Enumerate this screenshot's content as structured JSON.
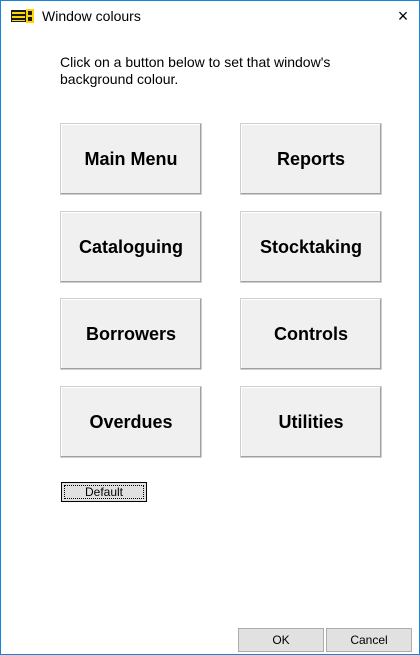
{
  "window": {
    "title": "Window colours",
    "close_glyph": "×",
    "app_icon": "library-app-icon"
  },
  "instructions": "Click on a button below to set that window's background colour.",
  "buttons": {
    "main_menu": "Main Menu",
    "reports": "Reports",
    "cataloguing": "Cataloguing",
    "stocktaking": "Stocktaking",
    "borrowers": "Borrowers",
    "controls": "Controls",
    "overdues": "Overdues",
    "utilities": "Utilities"
  },
  "default_label": "Default",
  "ok_label": "OK",
  "cancel_label": "Cancel",
  "colors": {
    "accent_border": "#1883d7",
    "button_face": "#f0f0f0",
    "icon_yellow": "#ffd600"
  }
}
